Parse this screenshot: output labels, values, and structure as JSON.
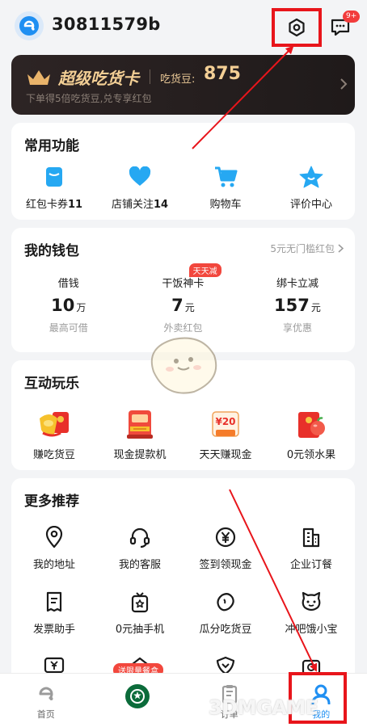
{
  "header": {
    "username": "30811579b",
    "message_badge": "9+"
  },
  "vip": {
    "title": "超级吃货卡",
    "bean_label": "吃货豆:",
    "bean_value": "875",
    "subtitle": "下单得5倍吃货豆,兑专享红包"
  },
  "common": {
    "title": "常用功能",
    "items": [
      {
        "label": "红包卡券",
        "count": "11",
        "icon": "coupon-icon"
      },
      {
        "label": "店铺关注",
        "count": "14",
        "icon": "heart-icon"
      },
      {
        "label": "购物车",
        "count": "",
        "icon": "cart-icon"
      },
      {
        "label": "评价中心",
        "count": "",
        "icon": "star-icon"
      }
    ]
  },
  "wallet": {
    "title": "我的钱包",
    "link": "5元无门槛红包",
    "items": [
      {
        "name": "借钱",
        "value": "10",
        "unit": "万",
        "desc": "最高可借"
      },
      {
        "name": "干饭神卡",
        "value": "7",
        "unit": "元",
        "desc": "外卖红包",
        "tag": "天天减"
      },
      {
        "name": "绑卡立减",
        "value": "157",
        "unit": "元",
        "desc": "享优惠"
      }
    ]
  },
  "play": {
    "title": "互动玩乐",
    "items": [
      {
        "label": "赚吃货豆"
      },
      {
        "label": "现金提款机"
      },
      {
        "label": "天天赚现金",
        "badge": "¥20"
      },
      {
        "label": "0元领水果"
      }
    ]
  },
  "more": {
    "title": "更多推荐",
    "rows": [
      [
        {
          "label": "我的地址",
          "icon": "location-icon"
        },
        {
          "label": "我的客服",
          "icon": "headset-icon"
        },
        {
          "label": "签到领现金",
          "icon": "yen-icon"
        },
        {
          "label": "企业订餐",
          "icon": "building-icon"
        }
      ],
      [
        {
          "label": "发票助手",
          "icon": "receipt-icon"
        },
        {
          "label": "0元抽手机",
          "icon": "gift-phone-icon"
        },
        {
          "label": "瓜分吃货豆",
          "icon": "bean-icon"
        },
        {
          "label": "冲吧饿小宝",
          "icon": "pet-icon"
        }
      ]
    ]
  },
  "promo_tag": "送限量餐盒",
  "tabs": [
    {
      "label": "首页"
    },
    {
      "label": ""
    },
    {
      "label": "订单"
    },
    {
      "label": "我的"
    }
  ],
  "watermark": "3DMGAME",
  "colors": {
    "accent": "#1f8ff2",
    "highlight_border": "#e8151b",
    "arrow": "#e8151b"
  }
}
